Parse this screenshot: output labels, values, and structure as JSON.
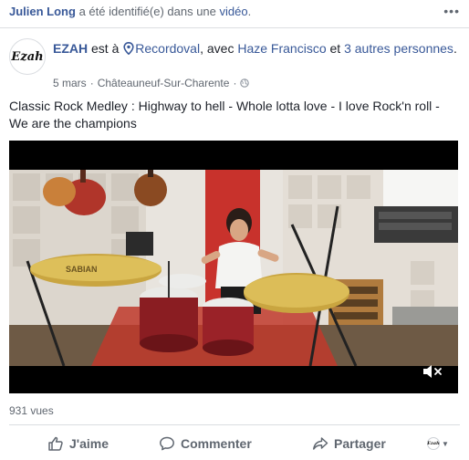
{
  "notification": {
    "tagged_name": "Julien Long",
    "text": " a été identifié(e) dans une ",
    "video_link": "vidéo",
    "period": "."
  },
  "post": {
    "author": "EZAH",
    "avatar_text": "Ezah",
    "at_text": " est à ",
    "place": "Recordoval",
    "with_text": ", avec ",
    "friend": "Haze Francisco",
    "and_text": " et ",
    "others": "3 autres personnes",
    "end": ".",
    "date": "5 mars",
    "separator": "·",
    "location": "Châteauneuf-Sur-Charente",
    "separator2": "·",
    "description": "Classic Rock Medley : Highway to hell - Whole lotta love - I love Rock'n roll - We are the champions"
  },
  "video": {
    "cymbal_brand": "SABIAN",
    "views": "931 vues"
  },
  "actions": {
    "like": "J'aime",
    "comment": "Commenter",
    "share": "Partager"
  },
  "icons": {
    "more": "more-dots-icon",
    "pin": "location-pin-icon",
    "globe": "globe-icon",
    "mute": "muted-speaker-icon",
    "like": "thumbs-up-icon",
    "comment": "speech-bubble-icon",
    "share": "share-arrow-icon"
  },
  "colors": {
    "link": "#385898",
    "meta": "#606770",
    "text": "#1d2129",
    "divider": "#dadde1"
  }
}
